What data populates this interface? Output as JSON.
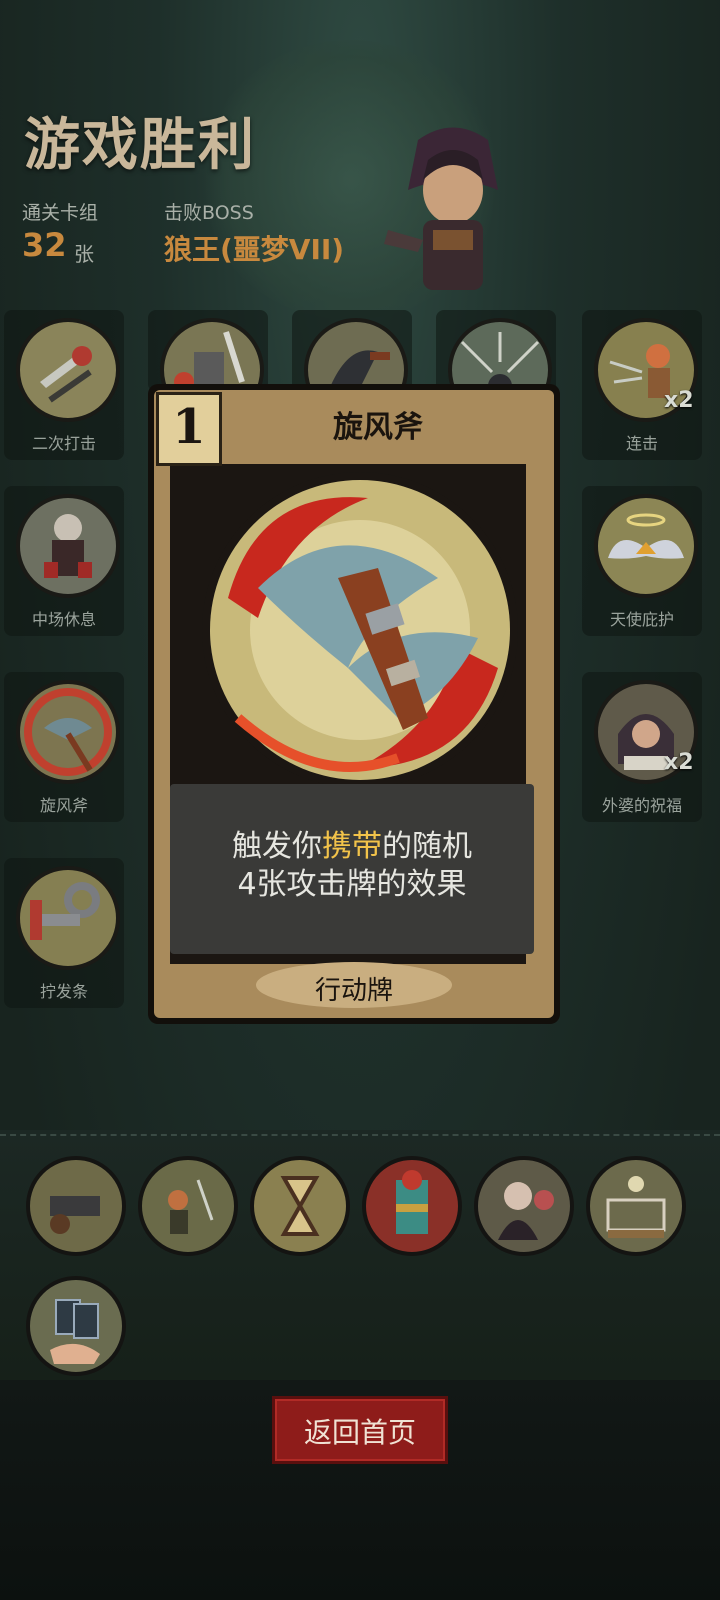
{
  "header": {
    "title": "游戏胜利",
    "deck_label": "通关卡组",
    "deck_count": "32",
    "deck_unit": "张",
    "boss_label": "击败BOSS",
    "boss_name": "狼王(噩梦VII)"
  },
  "relics": [
    {
      "label": "二次打击",
      "badge": "",
      "icon": "double-strike-icon",
      "color": "#8a845a"
    },
    {
      "label": "",
      "badge": "",
      "icon": "hammer-icon",
      "color": "#7a7654"
    },
    {
      "label": "",
      "badge": "",
      "icon": "axe-icon",
      "color": "#6e6c52"
    },
    {
      "label": "",
      "badge": "",
      "icon": "arrow-volley-icon",
      "color": "#5d6a5a"
    },
    {
      "label": "连击",
      "badge": "x2",
      "icon": "archer-icon",
      "color": "#87804f"
    },
    {
      "label": "中场休息",
      "badge": "",
      "icon": "resting-knight-icon",
      "color": "#6d7061"
    },
    {
      "label": "天使庇护",
      "badge": "",
      "icon": "angel-wings-icon",
      "color": "#8c8655"
    },
    {
      "label": "旋风斧",
      "badge": "",
      "icon": "whirlwind-axe-icon",
      "color": "#7d7550"
    },
    {
      "label": "外婆的祝福",
      "badge": "x2",
      "icon": "grandma-icon",
      "color": "#5f5a4a"
    },
    {
      "label": "拧发条",
      "badge": "",
      "icon": "wind-up-key-icon",
      "color": "#857f52"
    }
  ],
  "card": {
    "cost": "1",
    "name": "旋风斧",
    "desc_line1_pre": "触发你",
    "desc_highlight": "携带",
    "desc_line1_post": "的随机",
    "desc_line2": "4张攻击牌的效果",
    "type": "行动牌",
    "highlight_color": "#f2c34a"
  },
  "bottom_relics": [
    {
      "icon": "cannon-icon"
    },
    {
      "icon": "battle-scene-icon"
    },
    {
      "icon": "hourglass-icon"
    },
    {
      "icon": "totem-icon"
    },
    {
      "icon": "vampire-icon"
    },
    {
      "icon": "boxing-ring-icon"
    },
    {
      "icon": "card-hand-icon"
    }
  ],
  "footer": {
    "back_label": "返回首页"
  }
}
